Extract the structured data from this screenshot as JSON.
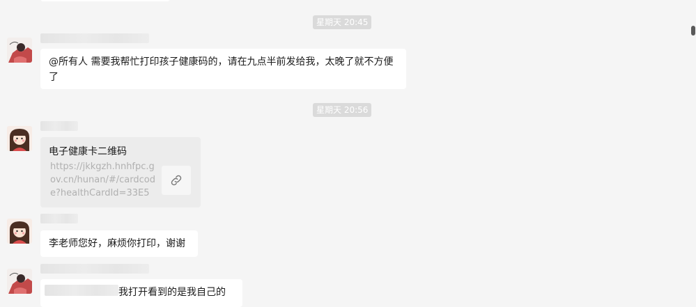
{
  "conversation": {
    "timestamps": [
      "星期天 20:45",
      "星期天 20:56"
    ],
    "messages": [
      {
        "type": "text",
        "text": "@所有人 需要我帮忙打印孩子健康码的，请在九点半前发给我，太晚了就不方便了"
      },
      {
        "type": "link",
        "title": "电子健康卡二维码",
        "url": "https://jkkgzh.hnhfpc.gov.cn/hunan/#/cardcode?healthCardId=33E55..."
      },
      {
        "type": "text",
        "text": "李老师您好，麻烦你打印，谢谢"
      },
      {
        "type": "text",
        "text": "我打开看到的是我自己的"
      }
    ]
  },
  "icons": {
    "link": "link-icon",
    "avatar_teacher": "avatar-teacher",
    "avatar_parent": "avatar-parent"
  }
}
